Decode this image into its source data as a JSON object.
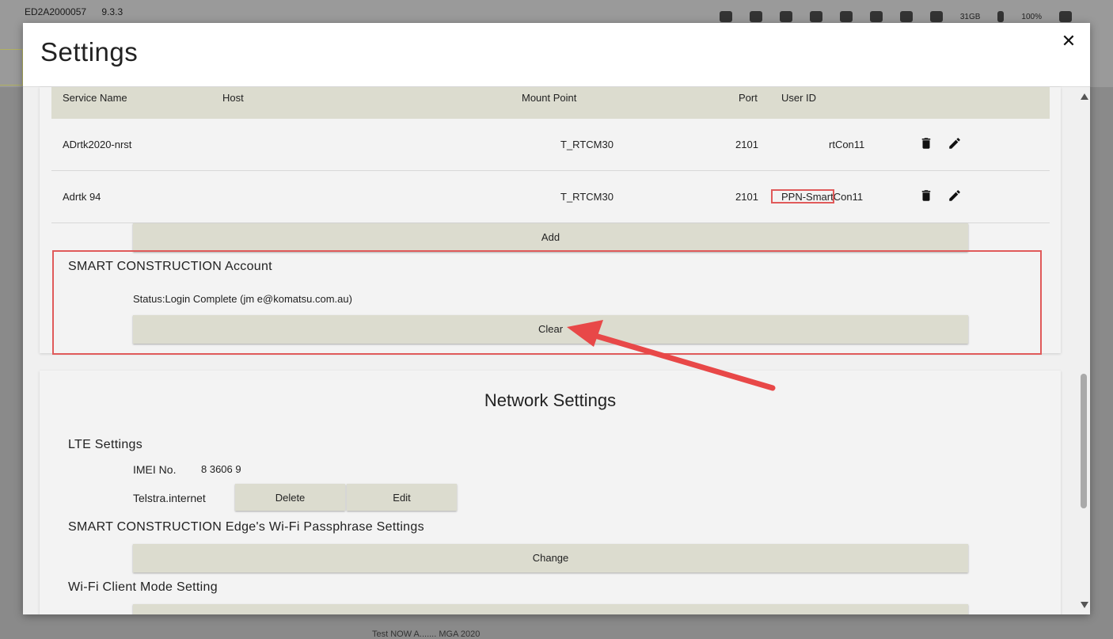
{
  "background": {
    "device_id": "ED2A2000057",
    "version": "9.3.3",
    "storage": "31GB",
    "battery": "100%",
    "footer_text": "Test NOW   A.......   MGA 2020"
  },
  "modal": {
    "title": "Settings",
    "close_label": "✕"
  },
  "ntrip_table": {
    "headers": [
      "Service Name",
      "Host",
      "Mount Point",
      "Port",
      "User ID"
    ],
    "rows": [
      {
        "service_name": "ADrtk2020-nrst",
        "host": "",
        "mount_point": "T_RTCM30",
        "port": "2101",
        "user_id": "rtCon11"
      },
      {
        "service_name": "Adrtk 94",
        "host": "",
        "mount_point": "T_RTCM30",
        "port": "2101",
        "user_id": "PPN-SmartCon11"
      }
    ],
    "add_label": "Add"
  },
  "smart_account": {
    "title": "SMART CONSTRUCTION Account",
    "status": "Status:Login Complete (jm            e@komatsu.com.au)",
    "clear_label": "Clear"
  },
  "network": {
    "title": "Network Settings",
    "lte_title": "LTE Settings",
    "imei_label": "IMEI No.",
    "imei_value": "8                         3606 9",
    "apn": "Telstra.internet",
    "delete_label": "Delete",
    "edit_label": "Edit",
    "wifi_pass_title": "SMART CONSTRUCTION Edge's Wi-Fi Passphrase Settings",
    "change_label": "Change",
    "wifi_client_title": "Wi-Fi Client Mode Setting"
  },
  "colors": {
    "annotation": "#e05a5a",
    "button_bg": "#dcdccf"
  }
}
